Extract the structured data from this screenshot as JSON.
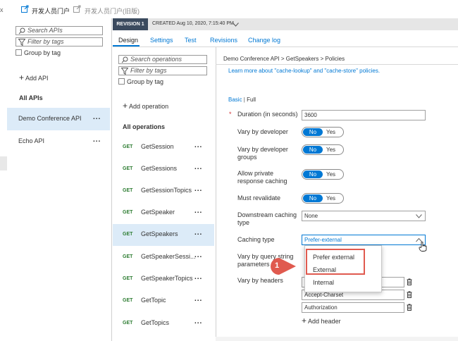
{
  "topbar": {
    "close_glyph": "x",
    "portal_link": "开发人员门户",
    "legacy_portal_link": "开发人员门户(旧版)"
  },
  "sidebar": {
    "search_placeholder": "Search APIs",
    "filter_placeholder": "Filter by tags",
    "group_by_tag": "Group by tag",
    "add_api": "Add API",
    "all_apis": "All APIs",
    "apis": [
      {
        "name": "Demo Conference API",
        "selected": true
      },
      {
        "name": "Echo API",
        "selected": false
      }
    ]
  },
  "revision": {
    "badge": "REVISION 1",
    "created": "CREATED Aug 10, 2020, 7:15:40 PM"
  },
  "tabs": [
    "Design",
    "Settings",
    "Test",
    "Revisions",
    "Change log"
  ],
  "operations": {
    "search_placeholder": "Search operations",
    "filter_placeholder": "Filter by tags",
    "group_by_tag": "Group by tag",
    "add_operation": "Add operation",
    "heading": "All operations",
    "items": [
      {
        "verb": "GET",
        "name": "GetSession"
      },
      {
        "verb": "GET",
        "name": "GetSessions"
      },
      {
        "verb": "GET",
        "name": "GetSessionTopics"
      },
      {
        "verb": "GET",
        "name": "GetSpeaker"
      },
      {
        "verb": "GET",
        "name": "GetSpeakers"
      },
      {
        "verb": "GET",
        "name": "GetSpeakerSessi..."
      },
      {
        "verb": "GET",
        "name": "GetSpeakerTopics"
      },
      {
        "verb": "GET",
        "name": "GetTopic"
      },
      {
        "verb": "GET",
        "name": "GetTopics"
      }
    ],
    "selected_index": 4
  },
  "policy": {
    "breadcrumb": "Demo Conference API > GetSpeakers > Policies",
    "learn_more": "Learn more about \"cache-lookup\" and \"cache-store\" policies.",
    "mode_basic": "Basic",
    "mode_separator": "|",
    "mode_full": "Full",
    "required_mark": "*",
    "duration_label": "Duration (in seconds)",
    "duration_value": "3600",
    "vary_developer_label": "Vary by developer",
    "vary_groups_label": "Vary by developer groups",
    "allow_private_label": "Allow private response caching",
    "must_revalidate_label": "Must revalidate",
    "toggle_no": "No",
    "toggle_yes": "Yes",
    "downstream_label": "Downstream caching type",
    "downstream_value": "None",
    "caching_type_label": "Caching type",
    "caching_type_value": "Prefer-external",
    "vary_query_label": "Vary by query string parameters",
    "vary_headers_label": "Vary by headers",
    "headers": [
      "",
      "Accept-Charset",
      "Authorization"
    ],
    "add_header": "Add header",
    "dropdown_options": [
      "Prefer external",
      "External",
      "Internal"
    ],
    "callout_number": "1"
  },
  "colors": {
    "accent": "#0078d4",
    "highlight": "#e05a4f",
    "callout": "#e05a4f",
    "selected_bg": "#dcebf8"
  }
}
